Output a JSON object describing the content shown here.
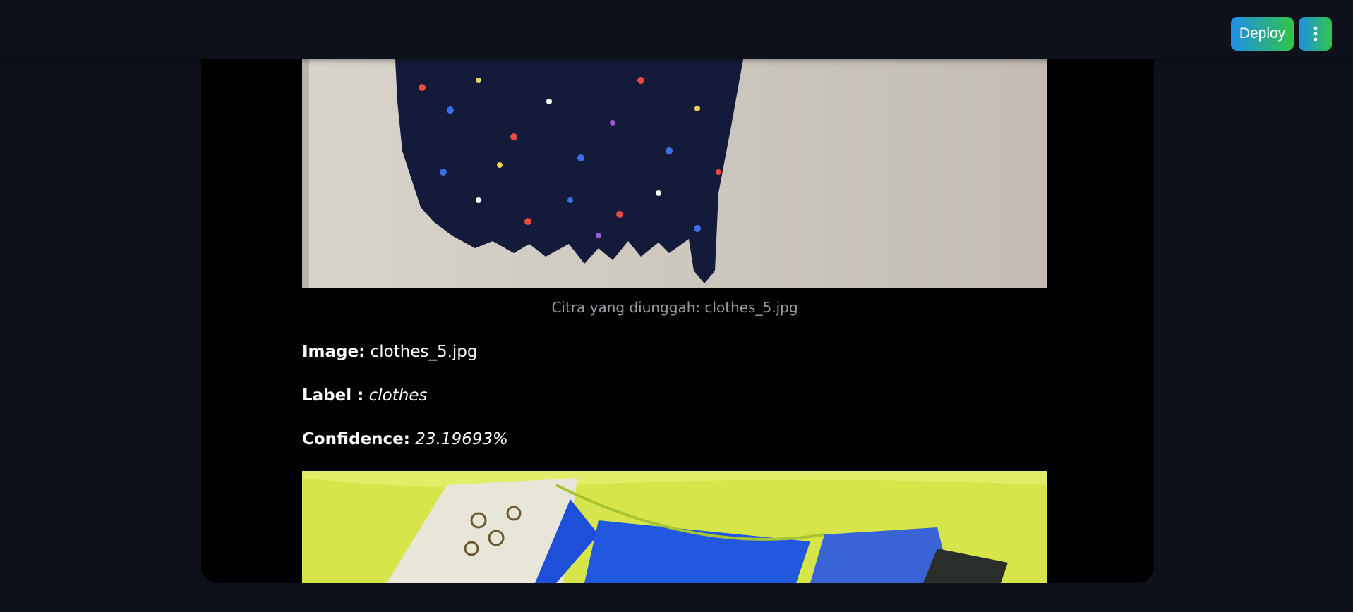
{
  "header": {
    "deploy_label": "Deploy",
    "menu_icon": "vertical-dots-icon"
  },
  "images": {
    "caption": "Citra yang diunggah: clothes_5.jpg"
  },
  "result": {
    "image_label": "Image:",
    "image_value": "clothes_5.jpg",
    "label_label": "Label :",
    "label_value": "clothes",
    "confidence_label": "Confidence:",
    "confidence_value": "23.19693%"
  },
  "colors": {
    "accent_start": "#1e8fe6",
    "accent_end": "#31c44a",
    "app_background": "#0e111a",
    "main_background": "#000000"
  }
}
